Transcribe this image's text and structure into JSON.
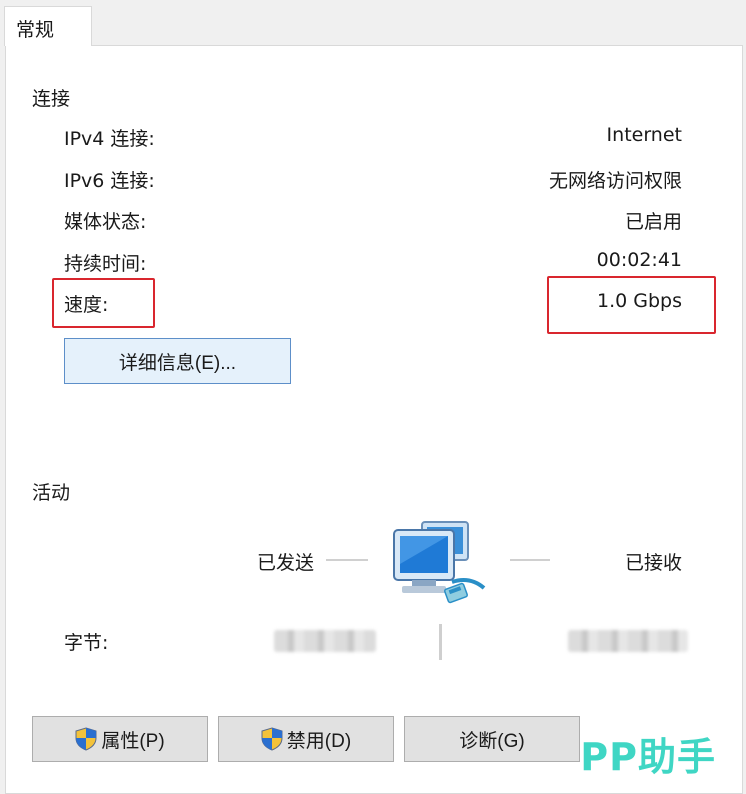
{
  "tab": {
    "label": "常规"
  },
  "connection": {
    "title": "连接",
    "rows": [
      {
        "label": "IPv4 连接:",
        "value": "Internet"
      },
      {
        "label": "IPv6 连接:",
        "value": "无网络访问权限"
      },
      {
        "label": "媒体状态:",
        "value": "已启用"
      },
      {
        "label": "持续时间:",
        "value": "00:02:41"
      },
      {
        "label": "速度:",
        "value": "1.0 Gbps"
      }
    ],
    "details_button": "详细信息(E)..."
  },
  "activity": {
    "title": "活动",
    "sent_label": "已发送",
    "received_label": "已接收",
    "bytes_label": "字节:"
  },
  "buttons": {
    "properties": "属性(P)",
    "disable": "禁用(D)",
    "diagnose": "诊断(G)"
  },
  "watermark": "PP助手",
  "colors": {
    "highlight": "#d9262e",
    "watermark": "#3fd6c4",
    "details_button_border": "#5d8fc9"
  },
  "icons": [
    "network-computers-icon",
    "uac-shield-icon"
  ]
}
